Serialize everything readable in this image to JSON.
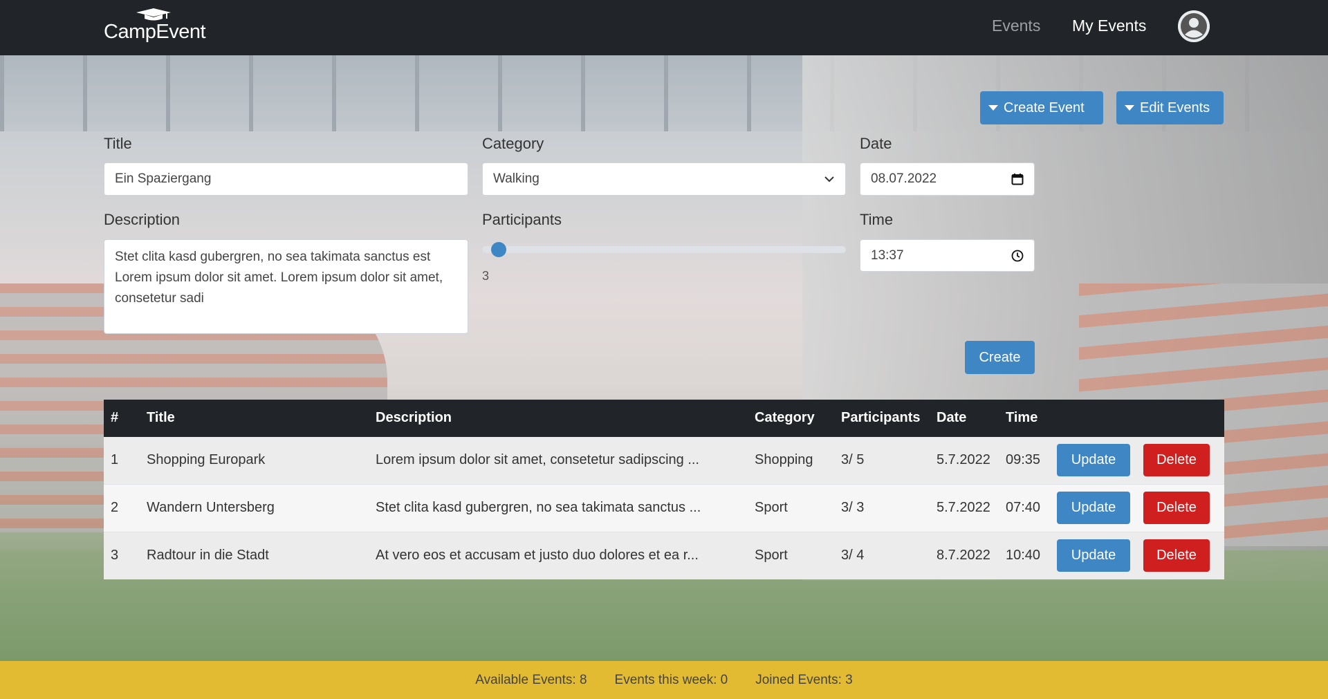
{
  "nav": {
    "brand": "CampEvent",
    "links": [
      "Events",
      "My Events"
    ]
  },
  "actions": {
    "create_event": "Create Event",
    "edit_events": "Edit Events"
  },
  "form": {
    "title_label": "Title",
    "title_value": "Ein Spaziergang",
    "category_label": "Category",
    "category_value": "Walking",
    "date_label": "Date",
    "date_value": "08.07.2022",
    "description_label": "Description",
    "description_value": "Stet clita kasd gubergren, no sea takimata sanctus est Lorem ipsum dolor sit amet. Lorem ipsum dolor sit amet, consetetur sadi",
    "participants_label": "Participants",
    "participants_value": 3,
    "participants_display": "3",
    "time_label": "Time",
    "time_value": "13:37",
    "create_button": "Create"
  },
  "table": {
    "headers": [
      "#",
      "Title",
      "Description",
      "Category",
      "Participants",
      "Date",
      "Time"
    ],
    "rows": [
      {
        "num": "1",
        "title": "Shopping Europark",
        "description": "Lorem ipsum dolor sit amet, consetetur sadipscing ...",
        "category": "Shopping",
        "participants": "3/ 5",
        "date": "5.7.2022",
        "time": "09:35"
      },
      {
        "num": "2",
        "title": "Wandern Untersberg",
        "description": "Stet clita kasd gubergren, no sea takimata sanctus ...",
        "category": "Sport",
        "participants": "3/ 3",
        "date": "5.7.2022",
        "time": "07:40"
      },
      {
        "num": "3",
        "title": "Radtour in die Stadt",
        "description": "At vero eos et accusam et justo duo dolores et ea r...",
        "category": "Sport",
        "participants": "3/ 4",
        "date": "8.7.2022",
        "time": "10:40"
      }
    ],
    "update_label": "Update",
    "delete_label": "Delete"
  },
  "footer": {
    "available": "Available Events: 8",
    "this_week": "Events this week: 0",
    "joined": "Joined Events: 3"
  },
  "colors": {
    "navbar": "#212529",
    "primary": "#3f87c4",
    "danger": "#d01f1f",
    "footer": "#e2bb32"
  },
  "icons": [
    "graduation-cap-icon",
    "user-circle-icon",
    "caret-down-icon",
    "chevron-down-icon",
    "calendar-icon",
    "clock-icon"
  ]
}
